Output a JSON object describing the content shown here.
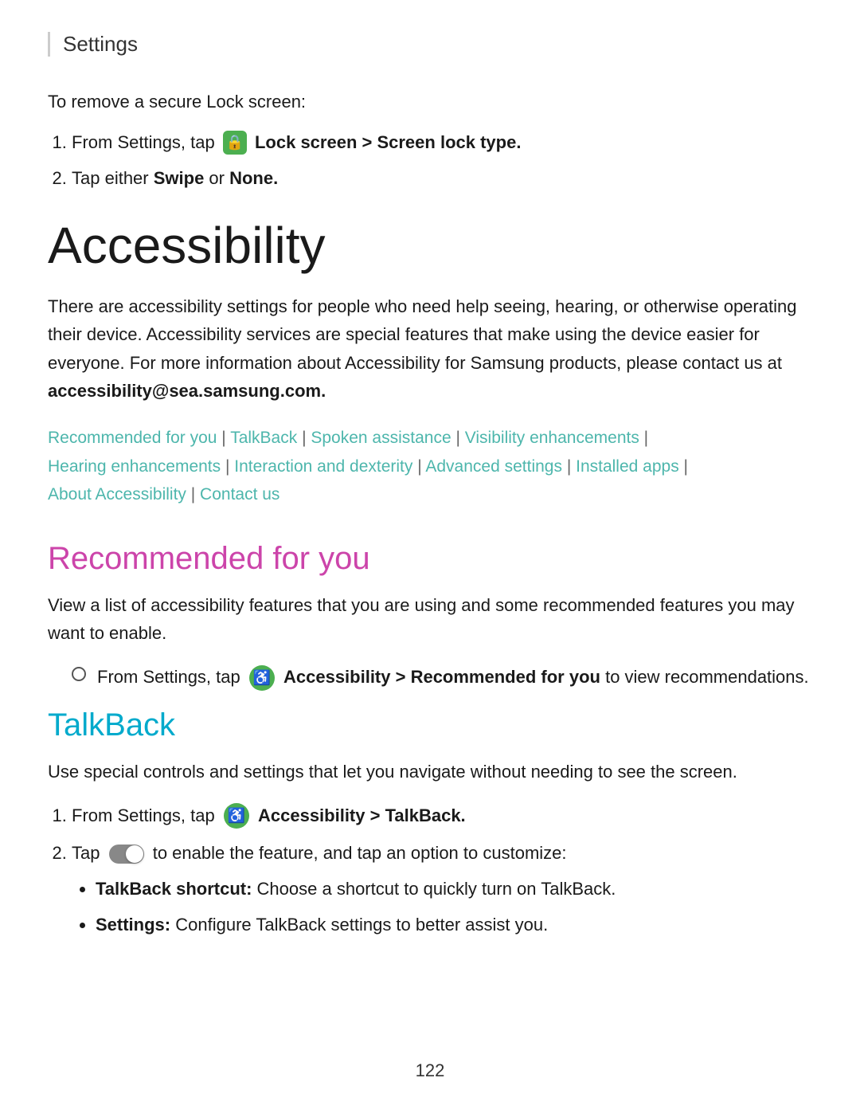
{
  "header": {
    "title": "Settings"
  },
  "intro": {
    "text": "To remove a secure Lock screen:",
    "steps": [
      {
        "id": 1,
        "text_before": "From Settings, tap",
        "icon": "lock-icon",
        "bold_text": "Lock screen > Screen lock type.",
        "text_after": ""
      },
      {
        "id": 2,
        "text_before": "Tap either",
        "bold1": "Swipe",
        "text_mid": "or",
        "bold2": "None.",
        "text_after": ""
      }
    ]
  },
  "accessibility": {
    "title": "Accessibility",
    "description": "There are accessibility settings for people who need help seeing, hearing, or otherwise operating their device. Accessibility services are special features that make using the device easier for everyone. For more information about Accessibility for Samsung products, please contact us at",
    "email": "accessibility@sea.samsung.com.",
    "nav_links": [
      "Recommended for you",
      "TalkBack",
      "Spoken assistance",
      "Visibility enhancements",
      "Hearing enhancements",
      "Interaction and dexterity",
      "Advanced settings",
      "Installed apps",
      "About Accessibility",
      "Contact us"
    ]
  },
  "recommended_section": {
    "title": "Recommended for you",
    "description": "View a list of accessibility features that you are using and some recommended features you may want to enable.",
    "step": {
      "text_before": "From Settings, tap",
      "bold_text": "Accessibility > Recommended for you",
      "text_after": "to view recommendations."
    }
  },
  "talkback_section": {
    "title": "TalkBack",
    "description": "Use special controls and settings that let you navigate without needing to see the screen.",
    "steps": [
      {
        "id": 1,
        "text_before": "From Settings, tap",
        "bold_text": "Accessibility > TalkBack."
      },
      {
        "id": 2,
        "text_before": "Tap",
        "icon": "toggle-icon",
        "text_after": "to enable the feature, and tap an option to customize:"
      }
    ],
    "bullet_items": [
      {
        "bold": "TalkBack shortcut:",
        "text": " Choose a shortcut to quickly turn on TalkBack."
      },
      {
        "bold": "Settings:",
        "text": " Configure TalkBack settings to better assist you."
      }
    ]
  },
  "page_number": "122"
}
